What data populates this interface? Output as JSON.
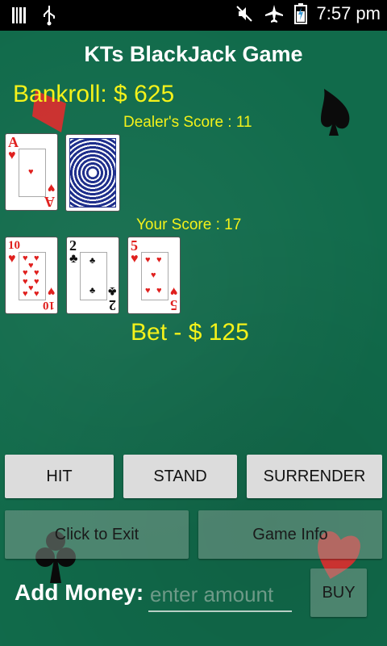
{
  "status_bar": {
    "time": "7:57 pm",
    "icons": [
      "barcode-icon",
      "usb-icon",
      "mute-icon",
      "airplane-icon",
      "battery-icon"
    ]
  },
  "app": {
    "title": "KTs BlackJack Game",
    "bankroll": "Bankroll:  $ 625",
    "dealer_score": "Dealer's Score : 11",
    "your_score": "Your Score : 17",
    "bet": "Bet - $ 125"
  },
  "dealer_cards": [
    {
      "rank": "A",
      "suit": "hearts",
      "symbol": "♥",
      "color": "#e0201e"
    },
    {
      "rank": "",
      "suit": "face-down"
    }
  ],
  "player_cards": [
    {
      "rank": "10",
      "suit": "hearts",
      "symbol": "♥",
      "color": "#e0201e"
    },
    {
      "rank": "2",
      "suit": "clubs",
      "symbol": "♣",
      "color": "#111111"
    },
    {
      "rank": "5",
      "suit": "hearts",
      "symbol": "♥",
      "color": "#e0201e"
    }
  ],
  "buttons": {
    "hit": "HIT",
    "stand": "STAND",
    "surrender": "SURRENDER",
    "exit": "Click to Exit",
    "game_info": "Game Info",
    "buy": "BUY"
  },
  "add_money": {
    "label": "Add Money:",
    "placeholder": "enter amount",
    "value": ""
  },
  "colors": {
    "felt": "#116b4b",
    "text_yellow": "#f4f21a",
    "button": "#dcdcdc"
  }
}
